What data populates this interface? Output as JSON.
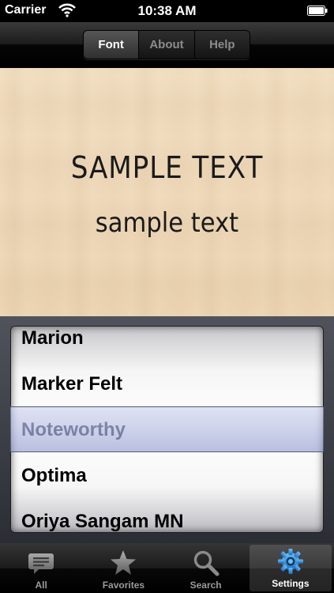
{
  "status_bar": {
    "carrier": "Carrier",
    "time": "10:38 AM",
    "icons": [
      "wifi-icon",
      "battery-icon"
    ]
  },
  "segmented_control": {
    "items": [
      {
        "label": "Font",
        "selected": true
      },
      {
        "label": "About",
        "selected": false
      },
      {
        "label": "Help",
        "selected": false
      }
    ]
  },
  "sample": {
    "upper": "SAMPLE TEXT",
    "lower": "sample text"
  },
  "picker": {
    "items": [
      "Marion",
      "Marker Felt",
      "Noteworthy",
      "Optima",
      "Oriya Sangam MN"
    ],
    "selected": "Noteworthy"
  },
  "tab_bar": {
    "items": [
      {
        "label": "All",
        "icon": "speech-bubble-icon",
        "active": false
      },
      {
        "label": "Favorites",
        "icon": "star-icon",
        "active": false
      },
      {
        "label": "Search",
        "icon": "magnifier-icon",
        "active": false
      },
      {
        "label": "Settings",
        "icon": "gear-icon",
        "active": true
      }
    ]
  },
  "colors": {
    "selection_tint": "#8c96d2",
    "wood": "#efd9b9",
    "active_tab_icon": "#2f8ad6"
  }
}
